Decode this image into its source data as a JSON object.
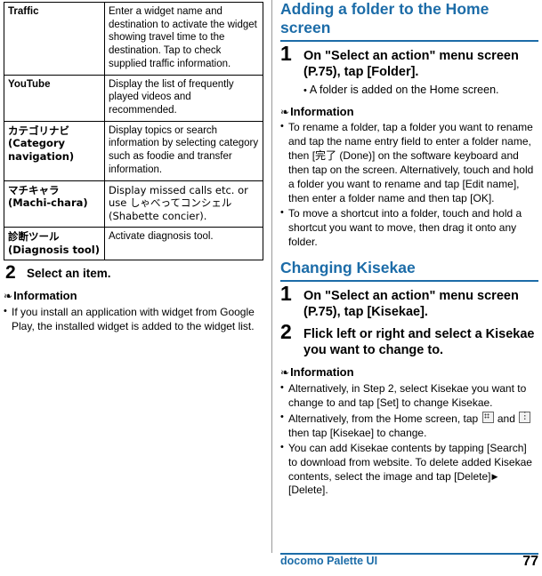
{
  "left_column": {
    "table": {
      "rows": [
        {
          "key": "Traffic",
          "value": "Enter a widget name and destination to activate the widget showing travel time to the destination. Tap to check supplied traffic information."
        },
        {
          "key": "YouTube",
          "value": "Display the list of frequently played videos and recommended."
        },
        {
          "key": "カテゴリナビ (Category navigation)",
          "value": "Display topics or search information by selecting category such as foodie and transfer information."
        },
        {
          "key": "マチキャラ (Machi-chara)",
          "value": "Display missed calls etc. or use しゃべってコンシェル (Shabette concier)."
        },
        {
          "key": "診断ツール (Diagnosis tool)",
          "value": "Activate diagnosis tool."
        }
      ]
    },
    "step": {
      "number": "2",
      "text": "Select an item."
    },
    "information": {
      "heading": "Information",
      "items": [
        "If you install an application with widget from Google Play, the installed widget is added to the widget list."
      ]
    }
  },
  "right_column": {
    "section1": {
      "heading": "Adding a folder to the Home screen",
      "step": {
        "number": "1",
        "text": "On \"Select an action\" menu screen (P.75), tap [Folder].",
        "substep": "A folder is added on the Home screen."
      },
      "information": {
        "heading": "Information",
        "items": [
          "To rename a folder, tap a folder you want to rename and tap the name entry field to enter a folder name, then [完了 (Done)] on the software keyboard and then tap on the screen. Alternatively, touch and hold a folder you want to rename and tap [Edit name], then enter a folder name and then tap [OK].",
          "To move a shortcut into a folder, touch and hold a shortcut you want to move, then drag it onto any folder."
        ]
      }
    },
    "section2": {
      "heading": "Changing Kisekae",
      "step1": {
        "number": "1",
        "text": "On \"Select an action\" menu screen (P.75), tap [Kisekae]."
      },
      "step2": {
        "number": "2",
        "text": "Flick left or right and select a Kisekae you want to change to."
      },
      "information": {
        "heading": "Information",
        "items": [
          {
            "parts": [
              "Alternatively, in Step 2, select Kisekae you want to change to and tap [Set] to change Kisekae."
            ]
          },
          {
            "parts": [
              "Alternatively, from the Home screen, tap ",
              "[grid-icon]",
              " and ",
              "[overflow-icon]",
              " then tap [Kisekae] to change."
            ]
          },
          {
            "parts": [
              "You can add Kisekae contents by tapping [Search] to download from website. To delete added Kisekae contents, select the image and tap [Delete]",
              "[arrow]",
              "[Delete]."
            ]
          }
        ]
      }
    }
  },
  "footer": {
    "title": "docomo Palette UI",
    "page": "77"
  },
  "colors": {
    "accent": "#1c6ca8",
    "text": "#000000",
    "rule": "#9a9a9a"
  }
}
